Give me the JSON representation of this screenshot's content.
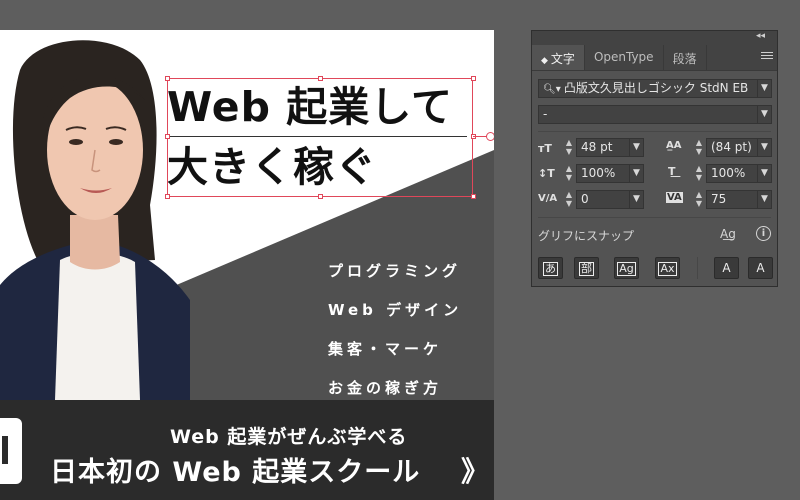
{
  "artboard": {
    "headline": {
      "line1": "Web 起業して",
      "line2": "大きく稼ぐ"
    },
    "services": [
      "プログラミング",
      "Web デザイン",
      "集客・マーケ",
      "お金の稼ぎ方"
    ],
    "banner": {
      "subtitle": "Web 起業がぜんぶ学べる",
      "title": "日本初の Web 起業スクール",
      "arrow": "》"
    },
    "colors": {
      "dark_triangle": "#505050",
      "banner": "#2b2b2b",
      "selection": "#e0475a"
    }
  },
  "character_panel": {
    "header": {
      "collapse": "◂◂",
      "close": "×"
    },
    "tabs": [
      {
        "label": "文字",
        "active": true
      },
      {
        "label": "OpenType",
        "active": false
      },
      {
        "label": "段落",
        "active": false
      }
    ],
    "font_family": "凸版文久見出しゴシック StdN EB",
    "font_style": "-",
    "font_size": "48 pt",
    "leading": "(84 pt)",
    "vertical_scale": "100%",
    "horizontal_scale": "100%",
    "kerning": "0",
    "tracking": "75",
    "snap_label": "グリフにスナップ",
    "snap_buttons": [
      "あ",
      "部",
      "Ag",
      "Ax",
      "A",
      "A"
    ]
  }
}
